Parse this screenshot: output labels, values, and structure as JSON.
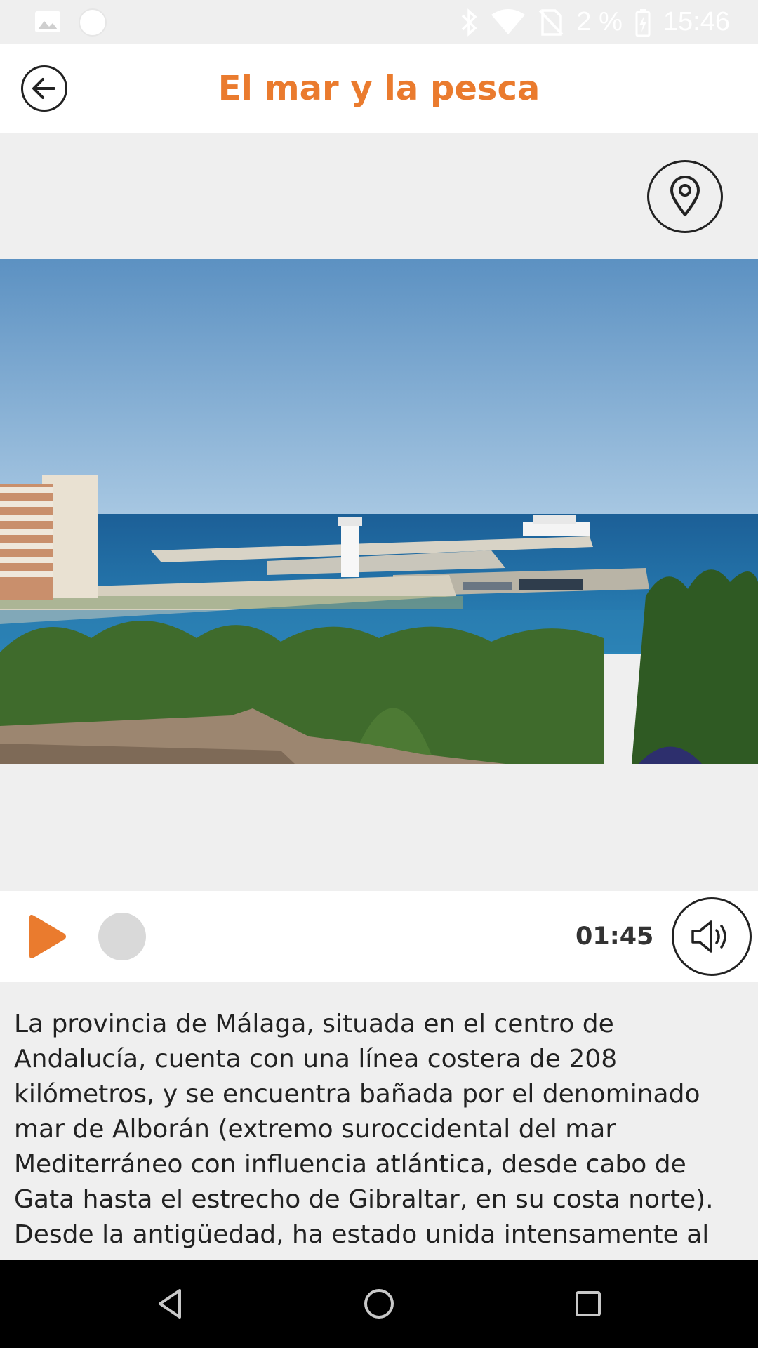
{
  "status_bar": {
    "battery_percent": "2 %",
    "time": "15:46",
    "icons": [
      "image-icon",
      "circle-icon",
      "bluetooth-icon",
      "wifi-icon",
      "no-sim-icon",
      "battery-charging-icon"
    ]
  },
  "header": {
    "title": "El mar y la pesca",
    "back_icon": "arrow-left-icon",
    "title_color": "#ea7b2e"
  },
  "location_button": {
    "icon": "map-pin-icon"
  },
  "hero_image": {
    "subject": "harbor-photo"
  },
  "player": {
    "duration": "01:45",
    "play_icon": "play-icon",
    "volume_icon": "volume-icon",
    "accent_color": "#ea7b2e",
    "progress": 0
  },
  "description": {
    "text": "La provincia de Málaga, situada en el centro de Andalucía, cuenta con una línea costera de 208 kilómetros, y se encuentra bañada por el denominado mar de Alborán (extremo suroccidental del mar Mediterráneo con influencia atlántica, desde cabo de Gata hasta el estrecho de Gibraltar, en su costa norte). Desde la antigüedad, ha estado unida intensamente al"
  },
  "nav_bar": {
    "icons": [
      "back-triangle-icon",
      "home-circle-icon",
      "recents-square-icon"
    ]
  }
}
